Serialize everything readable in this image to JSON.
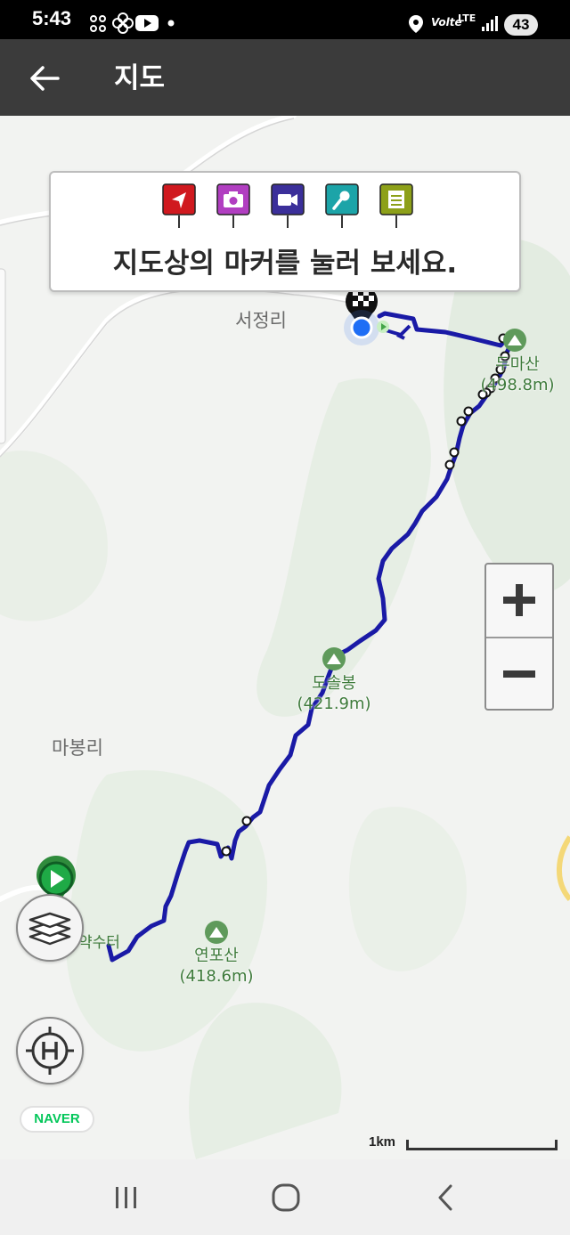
{
  "status_bar": {
    "time": "5:43",
    "network": "LTE",
    "volte": "Volte",
    "battery": "43",
    "icons": [
      "pinwheel-icon",
      "flower-icon",
      "youtube-icon",
      "dot-icon",
      "location-icon",
      "signal-icon"
    ]
  },
  "app_bar": {
    "title": "지도",
    "back_icon": "back-arrow-icon"
  },
  "banner": {
    "text": "지도상의 마커를 눌러 보세요.",
    "marker_types": [
      {
        "icon": "navigation-marker-icon",
        "color": "#d0191f"
      },
      {
        "icon": "camera-marker-icon",
        "color": "#b13ec1"
      },
      {
        "icon": "video-marker-icon",
        "color": "#3b2f9a"
      },
      {
        "icon": "microphone-marker-icon",
        "color": "#1ca4a8"
      },
      {
        "icon": "note-marker-icon",
        "color": "#8da019"
      }
    ]
  },
  "map": {
    "places": {
      "seojeong": "서정리",
      "mabong": "마봉리",
      "yaksuteo": "약수터"
    },
    "peaks": {
      "dumasan_name": "두마산",
      "dumasan_elev": "(498.8m)",
      "dosolbong_name": "도솔봉",
      "dosolbong_elev": "(421.9m)",
      "yeonposan_name": "연포산",
      "yeonposan_elev": "(418.6m)"
    },
    "route_color": "#1a1aa6",
    "scale_label": "1km",
    "provider": "NAVER"
  },
  "controls": {
    "zoom_in": "+",
    "zoom_out": "−"
  }
}
